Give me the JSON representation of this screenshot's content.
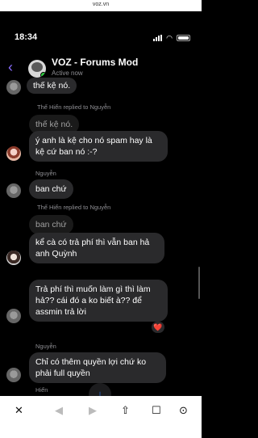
{
  "browser": {
    "url": "voz.vn"
  },
  "status_bar": {
    "time": "18:34"
  },
  "header": {
    "back_icon": "chevron-left-icon",
    "title": "VOZ - Forums Mod",
    "subtitle": "Active now"
  },
  "messages": [
    {
      "text": "thế kệ nó."
    },
    {
      "reply_tag": "Thế Hiển replied to Nguyễn",
      "quoted": "thế kệ nó.",
      "text": "ý anh là kệ cho nó spam hay là kệ cứ ban nó :-?"
    },
    {
      "sender": "Nguyễn",
      "text": "ban chứ"
    },
    {
      "reply_tag": "Thế Hiển replied to Nguyễn",
      "quoted": "ban chứ",
      "text": "kể cà có trả phí thì vẫn ban hả anh Quỳnh"
    },
    {
      "text": "Trả phí thì muốn làm gì thì làm hả?? cái đó a ko biết à?? để assmin trả lời",
      "reaction": "❤️"
    },
    {
      "sender": "Nguyễn",
      "text": "Chỉ có thêm quyền lợi chứ ko phải full quyền"
    },
    {
      "sender": "Hiển"
    }
  ],
  "bottom_bar": {
    "close": "✕",
    "back": "◀",
    "forward": "▶",
    "share": "⇧",
    "bookmarks": "☐",
    "compass": "⊙"
  }
}
